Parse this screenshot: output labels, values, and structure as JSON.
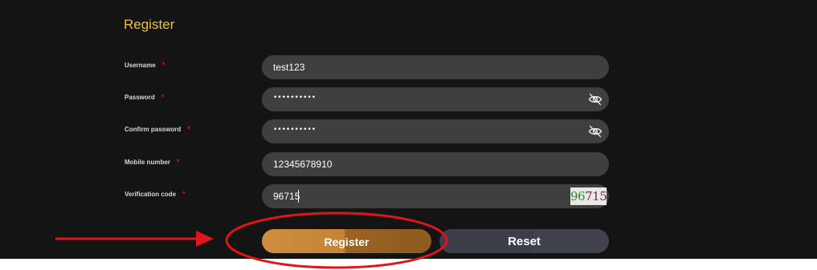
{
  "form": {
    "title": "Register",
    "required_mark": "*",
    "fields": [
      {
        "label": "Username",
        "value": "test123",
        "type": "text"
      },
      {
        "label": "Password",
        "value": "••••••••••",
        "type": "password"
      },
      {
        "label": "Confirm password",
        "value": "••••••••••",
        "type": "password"
      },
      {
        "label": "Mobile number",
        "value": "12345678910",
        "type": "text"
      },
      {
        "label": "Verification code",
        "value": "96715",
        "type": "text"
      }
    ],
    "captcha": {
      "chars": [
        "9",
        "6",
        "7",
        "1",
        "5"
      ],
      "colors": [
        "#2e8b2e",
        "#2e8b2e",
        "#7a1f6b",
        "#7a1f6b",
        "#7a1f6b"
      ]
    },
    "register_label": "Register",
    "reset_label": "Reset"
  },
  "colors": {
    "accent": "#f2c21b",
    "required": "#e0141b",
    "annotation": "#e0141b",
    "background": "#141414",
    "field": "#3f3f3f"
  },
  "icons": {
    "password_toggle": "eye-slash-icon"
  }
}
